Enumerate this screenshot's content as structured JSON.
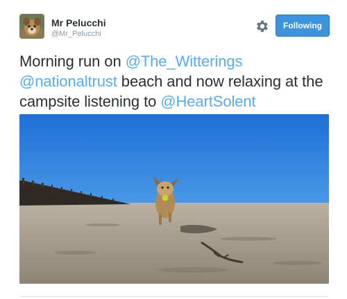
{
  "user": {
    "display_name": "Mr Pelucchi",
    "handle": "@Mr_Pelucchi"
  },
  "actions": {
    "follow_label": "Following",
    "settings_icon": "gear-icon"
  },
  "tweet": {
    "segments": [
      {
        "type": "text",
        "value": "Morning run on "
      },
      {
        "type": "mention",
        "value": "@The_Witterings"
      },
      {
        "type": "text",
        "value": " "
      },
      {
        "type": "mention",
        "value": "@nationaltrust"
      },
      {
        "type": "text",
        "value": " beach and now relaxing at the campsite listening to "
      },
      {
        "type": "mention",
        "value": "@HeartSolent"
      }
    ]
  },
  "colors": {
    "mention": "#55acee",
    "follow_button": "#3b94d9",
    "sky_top": "#1f6fd6",
    "sand": "#a89f90"
  }
}
